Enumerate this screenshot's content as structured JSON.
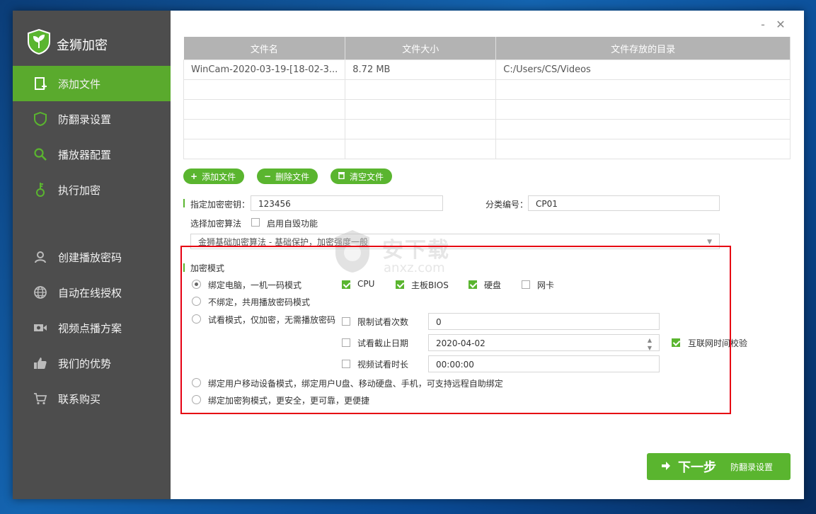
{
  "app": {
    "title": "金狮加密"
  },
  "sidebar": {
    "items": [
      {
        "label": "添加文件",
        "icon": "add-file-icon",
        "active": true
      },
      {
        "label": "防翻录设置",
        "icon": "shield-icon"
      },
      {
        "label": "播放器配置",
        "icon": "search-icon"
      },
      {
        "label": "执行加密",
        "icon": "key-icon"
      },
      {
        "label": "创建播放密码",
        "icon": "user-icon"
      },
      {
        "label": "自动在线授权",
        "icon": "globe-icon"
      },
      {
        "label": "视频点播方案",
        "icon": "video-icon"
      },
      {
        "label": "我们的优势",
        "icon": "thumbs-up-icon"
      },
      {
        "label": "联系购买",
        "icon": "cart-icon"
      }
    ]
  },
  "window_controls": {
    "minimize": "-",
    "close": "✕"
  },
  "file_table": {
    "headers": [
      "文件名",
      "文件大小",
      "文件存放的目录"
    ],
    "rows": [
      [
        "WinCam-2020-03-19-[18-02-3...",
        "8.72 MB",
        "C:/Users/CS/Videos"
      ],
      [
        "",
        "",
        ""
      ],
      [
        "",
        "",
        ""
      ],
      [
        "",
        "",
        ""
      ],
      [
        "",
        "",
        ""
      ]
    ]
  },
  "file_actions": {
    "add": "添加文件",
    "delete": "删除文件",
    "clear": "清空文件"
  },
  "key_section": {
    "key_label": "指定加密密钥：",
    "key_value": "123456",
    "category_label": "分类编号：",
    "category_value": "CP01",
    "algo_label": "选择加密算法",
    "self_destruct_label": "启用自毁功能",
    "algo_value": "金狮基础加密算法 - 基础保护，加密强度一般"
  },
  "mode": {
    "title": "加密模式",
    "options": [
      "绑定电脑，一机一码模式",
      "不绑定，共用播放密码模式",
      "试看模式，仅加密，无需播放密码",
      "绑定用户移动设备模式，绑定用户U盘、移动硬盘、手机，可支持远程自助绑定",
      "绑定加密狗模式，更安全，更可靠，更便捷"
    ],
    "hardware": [
      {
        "label": "CPU",
        "checked": true
      },
      {
        "label": "主板BIOS",
        "checked": true
      },
      {
        "label": "硬盘",
        "checked": true
      },
      {
        "label": "网卡",
        "checked": false
      }
    ],
    "trial": {
      "limit_count_label": "限制试看次数",
      "limit_count_value": "0",
      "deadline_label": "试看截止日期",
      "deadline_value": "2020-04-02",
      "internet_time_label": "互联网时间校验",
      "duration_label": "视频试看时长",
      "duration_value": "00:00:00"
    }
  },
  "next": {
    "label": "下一步",
    "sub": "防翻录设置"
  },
  "watermark": {
    "text": "安下载",
    "sub": "anxz.com"
  },
  "colors": {
    "accent": "#5ab52f",
    "sidebar": "#4d4d4d",
    "highlight_box": "#e60012"
  }
}
